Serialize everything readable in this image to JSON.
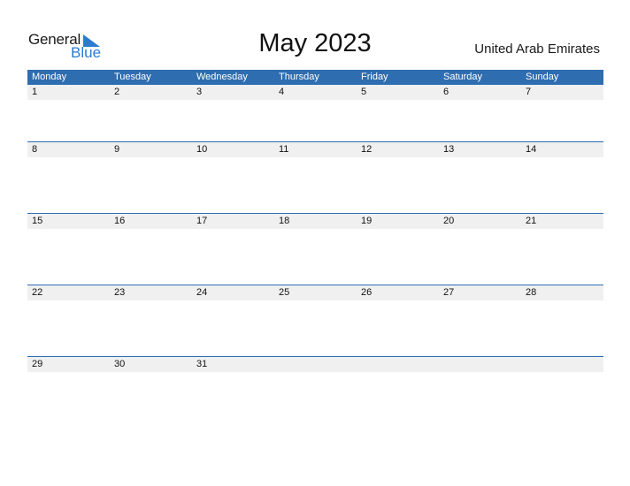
{
  "logo": {
    "general": "General",
    "blue": "Blue",
    "accent_color": "#2b7ccf"
  },
  "title": "May 2023",
  "country": "United Arab Emirates",
  "colors": {
    "header_bg": "#2e6db0",
    "band_bg": "#f0f0f0"
  },
  "weekdays": [
    "Monday",
    "Tuesday",
    "Wednesday",
    "Thursday",
    "Friday",
    "Saturday",
    "Sunday"
  ],
  "weeks": [
    [
      "1",
      "2",
      "3",
      "4",
      "5",
      "6",
      "7"
    ],
    [
      "8",
      "9",
      "10",
      "11",
      "12",
      "13",
      "14"
    ],
    [
      "15",
      "16",
      "17",
      "18",
      "19",
      "20",
      "21"
    ],
    [
      "22",
      "23",
      "24",
      "25",
      "26",
      "27",
      "28"
    ],
    [
      "29",
      "30",
      "31",
      "",
      "",
      "",
      ""
    ]
  ]
}
